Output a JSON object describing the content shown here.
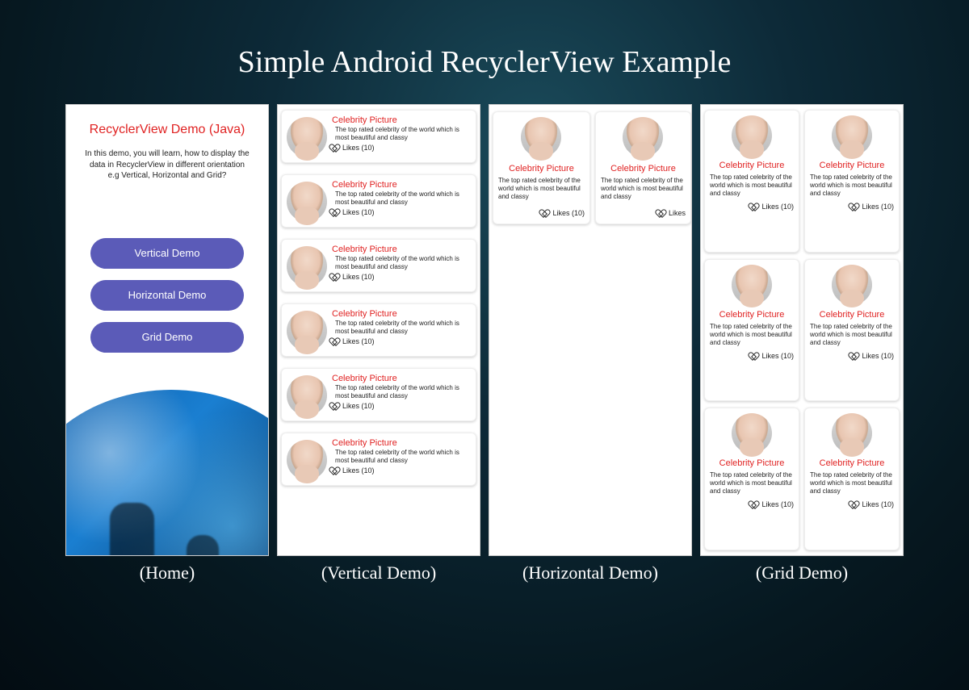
{
  "title": "Simple Android RecyclerView Example",
  "captions": {
    "home": "(Home)",
    "vertical": "(Vertical Demo)",
    "horizontal": "(Horizontal Demo)",
    "grid": "(Grid Demo)"
  },
  "home": {
    "title": "RecyclerView Demo (Java)",
    "description": "In this demo, you will learn, how to display the data in RecyclerView in different orientation e.g Vertical, Horizontal and Grid?",
    "buttons": {
      "vertical": "Vertical Demo",
      "horizontal": "Horizontal Demo",
      "grid": "Grid Demo"
    }
  },
  "card": {
    "title": "Celebrity Picture",
    "description": "The top rated celebrity of the world which is most beautiful and classy",
    "likes_label": "Likes (10)",
    "likes_label_short": "Likes"
  }
}
